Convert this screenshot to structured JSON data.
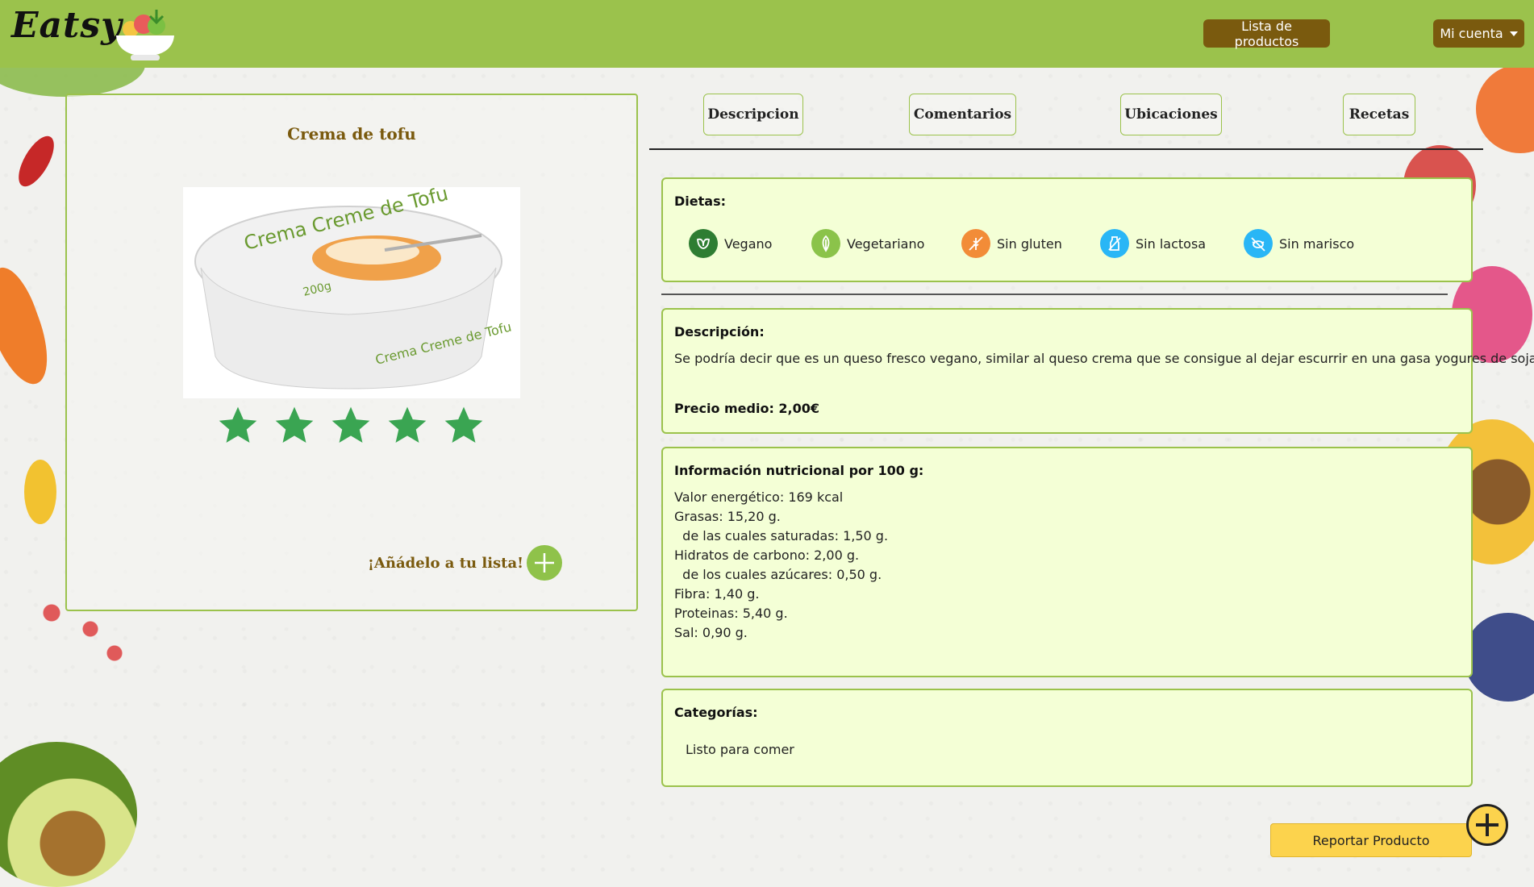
{
  "navbar": {
    "brand": "Eatsy",
    "products_button": "Lista de productos",
    "account_button": "Mi cuenta"
  },
  "product": {
    "title": "Crema de tofu",
    "image_label": "Crema Creme de Tofu",
    "image_weight": "200g",
    "rating": 5,
    "rating_max": 5,
    "add_to_list_label": "¡Añádelo a tu lista!"
  },
  "tabs": [
    {
      "label": "Descripcion"
    },
    {
      "label": "Comentarios"
    },
    {
      "label": "Ubicaciones"
    },
    {
      "label": "Recetas"
    }
  ],
  "diets": {
    "label": "Dietas:",
    "items": [
      {
        "label": "Vegano",
        "icon": "vegan-icon",
        "color": "#2e7d32"
      },
      {
        "label": "Vegetariano",
        "icon": "leaf-icon",
        "color": "#8bc34a"
      },
      {
        "label": "Sin gluten",
        "icon": "gluten-free-icon",
        "color": "#f28c38"
      },
      {
        "label": "Sin lactosa",
        "icon": "lactose-free-icon",
        "color": "#29b6f6"
      },
      {
        "label": "Sin marisco",
        "icon": "seafood-free-icon",
        "color": "#29b6f6"
      }
    ]
  },
  "description": {
    "label": "Descripción:",
    "text": "Se podría decir que es un queso fresco vegano, similar al queso crema que se consigue al dejar escurrir en una gasa yogures de soja.",
    "price": "Precio medio: 2,00€"
  },
  "nutrition": {
    "label": "Información nutricional por 100 g:",
    "lines": [
      "Valor energético: 169 kcal",
      "Grasas: 15,20 g.",
      "  de las cuales saturadas: 1,50 g.",
      "Hidratos de carbono: 2,00 g.",
      "  de los cuales azúcares: 0,50 g.",
      "Fibra: 1,40 g.",
      "Proteinas: 5,40 g.",
      "Sal: 0,90 g."
    ]
  },
  "categories": {
    "label": "Categorías:",
    "items": [
      "Listo para comer"
    ]
  },
  "report_button": "Reportar Producto",
  "colors": {
    "navbar": "#9bc24c",
    "brown": "#7a5a0e",
    "panel_bg": "#f4ffd6",
    "star": "#3aa552",
    "report": "#fcd34d"
  }
}
